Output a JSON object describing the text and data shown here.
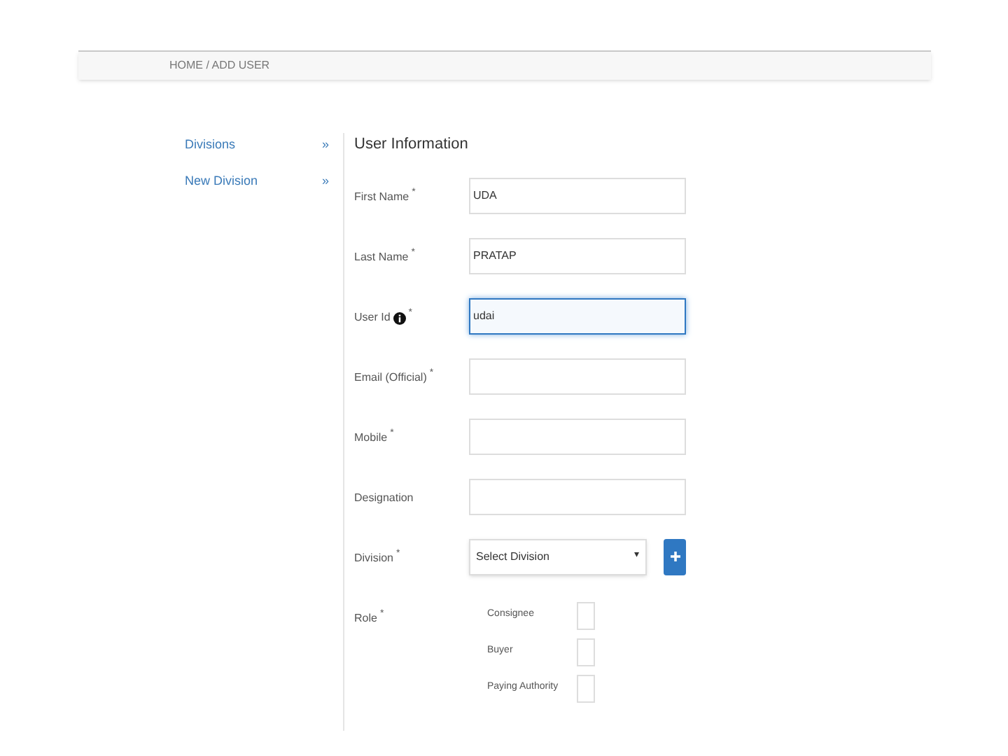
{
  "breadcrumb": "HOME / ADD USER",
  "sidebar": {
    "items": [
      {
        "label": "Divisions",
        "chevron": "»"
      },
      {
        "label": "New Division",
        "chevron": "»"
      }
    ]
  },
  "form": {
    "title": "User Information",
    "fields": [
      {
        "kind": "text",
        "label": "First Name",
        "required_mark": "*",
        "info": false,
        "value": "UDA",
        "focused": false
      },
      {
        "kind": "text",
        "label": "Last Name",
        "required_mark": "*",
        "info": false,
        "value": "PRATAP",
        "focused": false
      },
      {
        "kind": "text",
        "label": "User Id",
        "required_mark": "*",
        "info": true,
        "value": "udai",
        "focused": true
      },
      {
        "kind": "text",
        "label": "Email (Official)",
        "required_mark": "*",
        "info": false,
        "focused": false
      },
      {
        "kind": "text",
        "label": "Mobile",
        "required_mark": "*",
        "info": false,
        "focused": false
      },
      {
        "kind": "text",
        "label": "Designation",
        "info": false,
        "focused": false
      },
      {
        "kind": "select",
        "label": "Division",
        "required_mark": "*",
        "info": false,
        "value": "Select Division",
        "caret": "▾",
        "focused": false
      }
    ],
    "role": {
      "label": "Role",
      "required_mark": "*",
      "options": [
        {
          "label": "Consignee",
          "checked": false
        },
        {
          "label": "Buyer",
          "checked": false
        },
        {
          "label": "Paying Authority",
          "checked": false
        }
      ]
    }
  }
}
